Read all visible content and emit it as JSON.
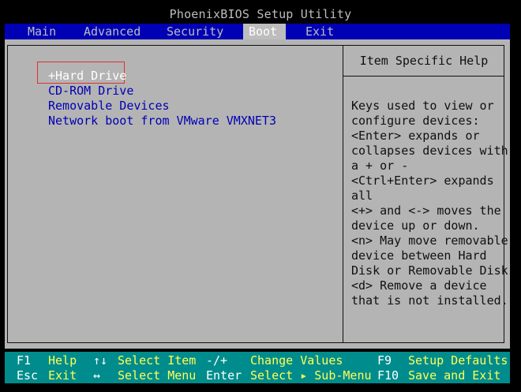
{
  "title": "PhoenixBIOS Setup Utility",
  "menu": {
    "tabs": [
      {
        "label": "Main"
      },
      {
        "label": "Advanced"
      },
      {
        "label": "Security"
      },
      {
        "label": "Boot"
      },
      {
        "label": "Exit"
      }
    ],
    "active": "Boot"
  },
  "boot_order": [
    {
      "label": "+Hard Drive",
      "selected": true
    },
    {
      "label": "CD-ROM Drive"
    },
    {
      "label": "Removable Devices"
    },
    {
      "label": "Network boot from VMware VMXNET3"
    }
  ],
  "help": {
    "title": "Item Specific Help",
    "lines": [
      "Keys used to view or",
      "configure devices:",
      "<Enter> expands or",
      "collapses devices with",
      "a + or -",
      "<Ctrl+Enter> expands",
      "all",
      "<+> and <-> moves the",
      "device up or down.",
      "<n> May move removable",
      "device between Hard",
      "Disk or Removable Disk",
      "<d> Remove a device",
      "that is not installed."
    ]
  },
  "footer": {
    "row1": [
      {
        "key": "F1",
        "desc": "Help"
      },
      {
        "key": "↑↓",
        "desc": "Select Item"
      },
      {
        "key": "-/+",
        "desc": "Change Values"
      },
      {
        "key": "F9",
        "desc": "Setup Defaults"
      }
    ],
    "row2": [
      {
        "key": "Esc",
        "desc": "Exit"
      },
      {
        "key": "↔",
        "desc": "Select Menu"
      },
      {
        "key": "Enter",
        "desc": "Select ▸ Sub-Menu"
      },
      {
        "key": "F10",
        "desc": "Save and Exit"
      }
    ]
  },
  "colors": {
    "menubar": "#0000b4",
    "content_bg": "#b4b4b4",
    "footer_bg": "#008c8c",
    "item_text": "#0000b4",
    "selected_text": "#ffffff",
    "highlight_box": "#e03030",
    "footer_key": "#ffffff",
    "footer_desc": "#ffff55"
  }
}
